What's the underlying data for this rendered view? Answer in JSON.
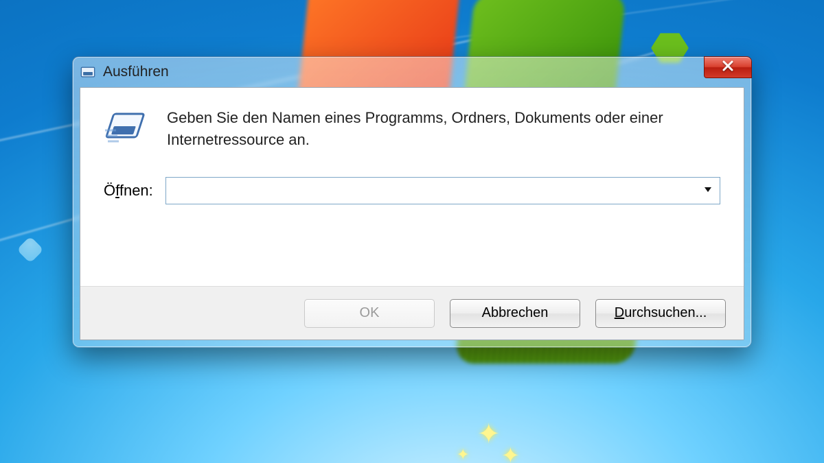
{
  "window": {
    "title": "Ausführen",
    "close_glyph": "x"
  },
  "body": {
    "instruction": "Geben Sie den Namen eines Programms, Ordners, Dokuments oder einer Internetressource an.",
    "open_label_pre": "Ö",
    "open_label_ul": "f",
    "open_label_post": "fnen:",
    "input_value": "",
    "input_placeholder": ""
  },
  "buttons": {
    "ok": "OK",
    "cancel": "Abbrechen",
    "browse_ul": "D",
    "browse_post": "urchsuchen..."
  },
  "icons": {
    "title_icon": "run-dialog-icon",
    "body_icon": "run-dialog-icon",
    "close": "close-icon",
    "dropdown": "chevron-down-icon"
  }
}
